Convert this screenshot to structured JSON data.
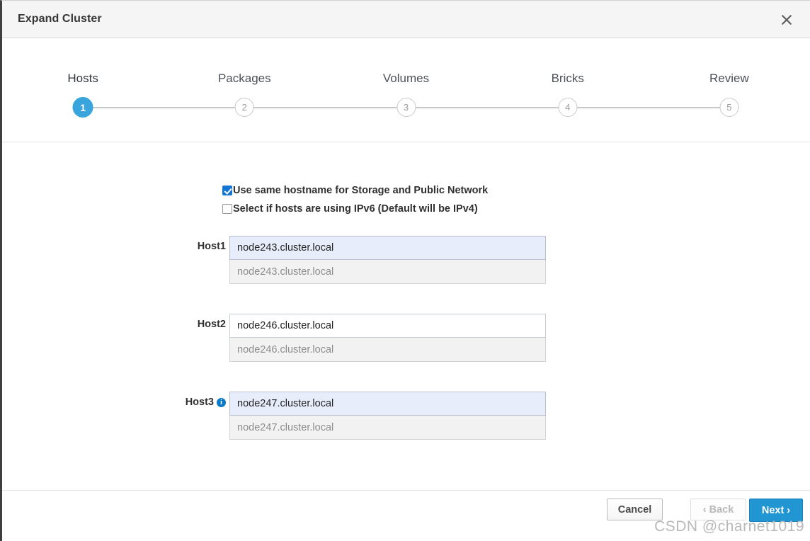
{
  "dialog": {
    "title": "Expand Cluster",
    "close_icon": "close-icon"
  },
  "wizard": {
    "steps": [
      {
        "number": "1",
        "label": "Hosts",
        "active": true
      },
      {
        "number": "2",
        "label": "Packages",
        "active": false
      },
      {
        "number": "3",
        "label": "Volumes",
        "active": false
      },
      {
        "number": "4",
        "label": "Bricks",
        "active": false
      },
      {
        "number": "5",
        "label": "Review",
        "active": false
      }
    ]
  },
  "options": [
    {
      "label": "Use same hostname for Storage and Public Network",
      "checked": true
    },
    {
      "label": "Select if hosts are using IPv6 (Default will be IPv4)",
      "checked": false
    }
  ],
  "hosts": [
    {
      "label": "Host1",
      "has_info_icon": false,
      "storage_value": "node243.cluster.local",
      "storage_highlighted": true,
      "public_value": "node243.cluster.local"
    },
    {
      "label": "Host2",
      "has_info_icon": false,
      "storage_value": "node246.cluster.local",
      "storage_highlighted": false,
      "public_value": "node246.cluster.local"
    },
    {
      "label": "Host3",
      "has_info_icon": true,
      "info_icon_glyph": "i",
      "storage_value": "node247.cluster.local",
      "storage_highlighted": true,
      "public_value": "node247.cluster.local"
    }
  ],
  "footer": {
    "cancel_label": "Cancel",
    "back_label": "‹ Back",
    "next_label": "Next ›"
  },
  "watermark": "CSDN @charnet1019",
  "colors": {
    "accent": "#39a5dc",
    "primary_button": "#2196d3",
    "checkbox_checked": "#1675d1",
    "info_icon": "#0a7bc4",
    "autofill_field": "#e8edfb",
    "readonly_field": "#f2f2f2",
    "header_bg": "#f5f5f5"
  }
}
